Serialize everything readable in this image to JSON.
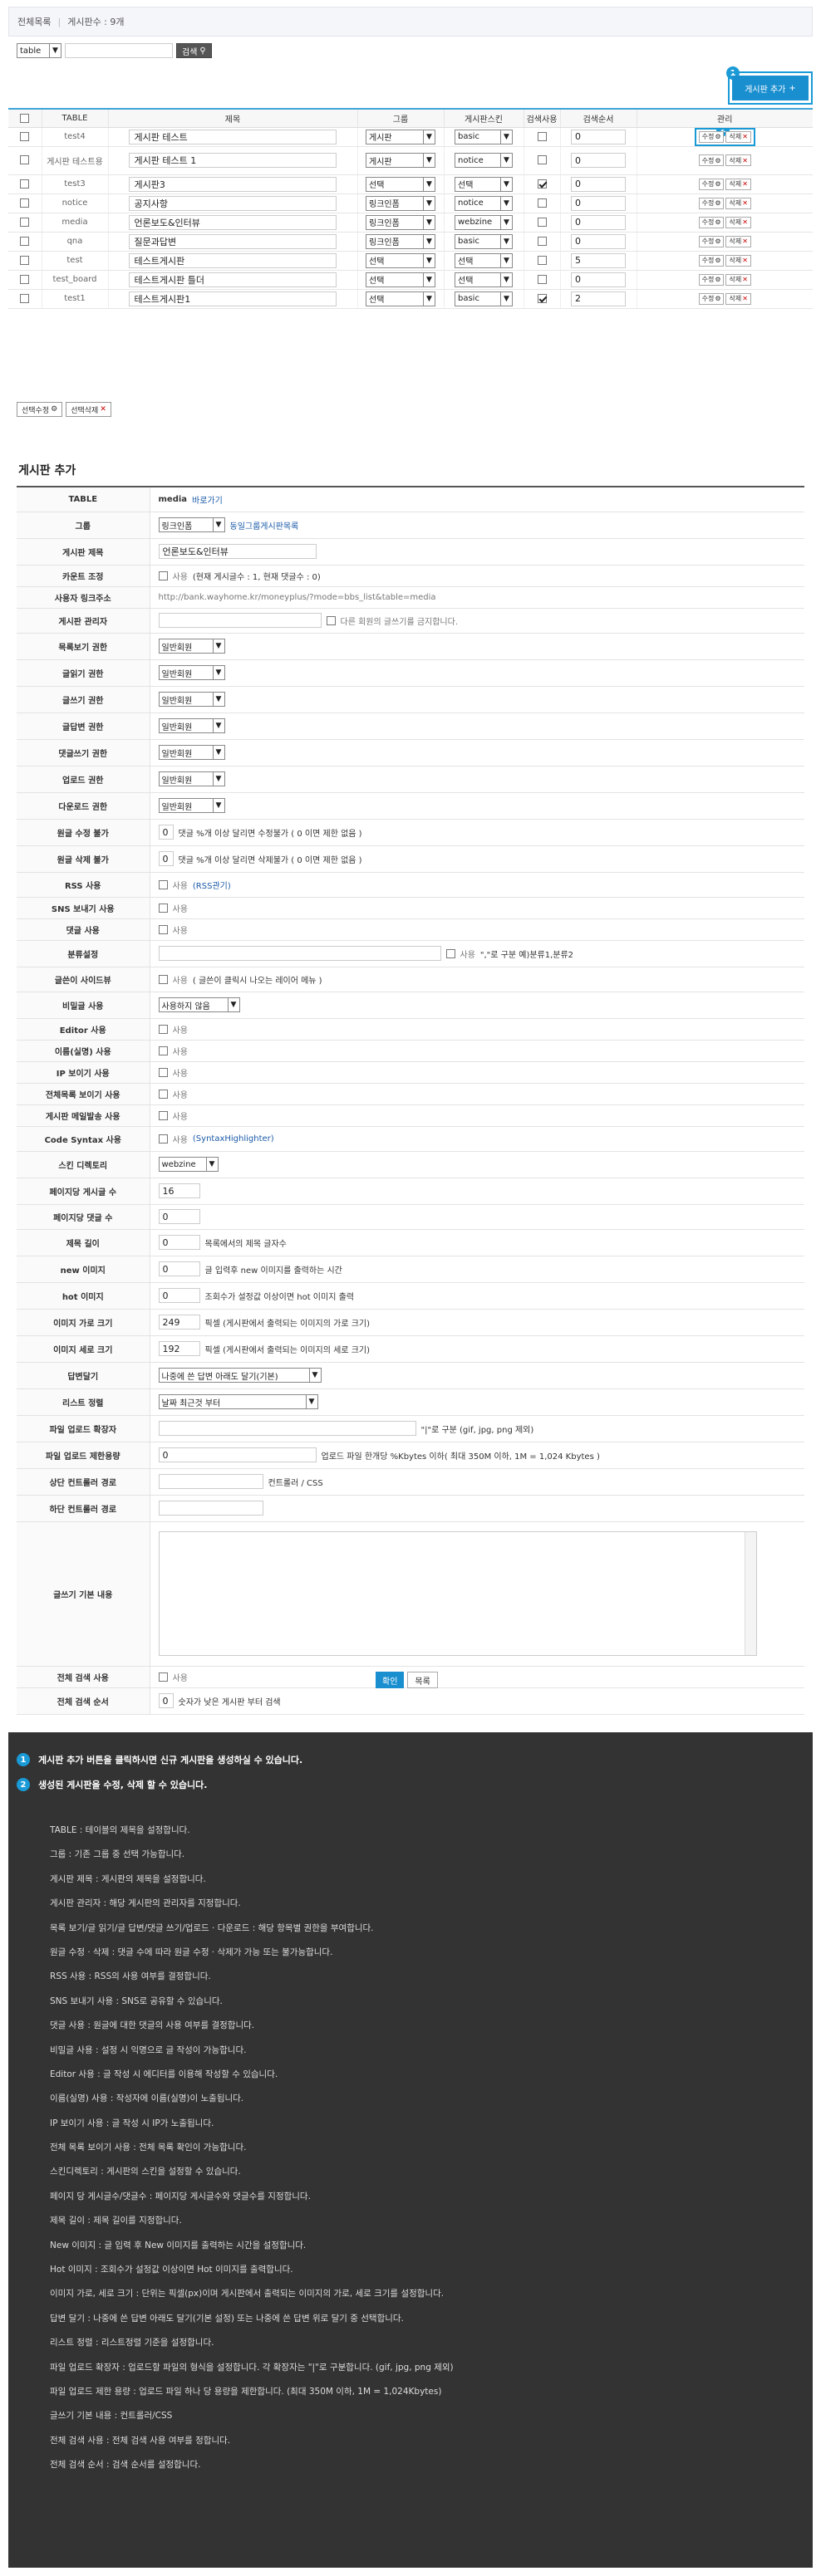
{
  "breadcrumb": {
    "title": "전체목록",
    "count_label": "게시판수 : 9개"
  },
  "search": {
    "field_value": "table",
    "query": "",
    "button": "검색"
  },
  "add_button": {
    "label": "게시판 추가",
    "badge1": "1",
    "badge2": "2"
  },
  "list": {
    "headers": [
      "TABLE",
      "제목",
      "그룹",
      "게시판스킨",
      "검색사용",
      "검색순서",
      "관리"
    ],
    "rows": [
      {
        "table": "test4",
        "title": "게시판 테스트",
        "group": "게시판",
        "skin": "basic",
        "search": false,
        "order": "0"
      },
      {
        "table": "게시판 테스트용",
        "title": "게시판 테스트 1",
        "group": "게시판",
        "skin": "notice",
        "search": false,
        "order": "0"
      },
      {
        "table": "test3",
        "title": "게시판3",
        "group": "선택",
        "skin": "선택",
        "search": true,
        "order": "0"
      },
      {
        "table": "notice",
        "title": "공지사항",
        "group": "링크인폼",
        "skin": "notice",
        "search": false,
        "order": "0"
      },
      {
        "table": "media",
        "title": "언론보도&인터뷰",
        "group": "링크인폼",
        "skin": "webzine",
        "search": false,
        "order": "0"
      },
      {
        "table": "qna",
        "title": "질문과답변",
        "group": "링크인폼",
        "skin": "basic",
        "search": false,
        "order": "0"
      },
      {
        "table": "test",
        "title": "테스트게시판",
        "group": "선택",
        "skin": "선택",
        "search": false,
        "order": "5"
      },
      {
        "table": "test_board",
        "title": "테스트게시판 틀더",
        "group": "선택",
        "skin": "선택",
        "search": false,
        "order": "0"
      },
      {
        "table": "test1",
        "title": "테스트게시판1",
        "group": "선택",
        "skin": "basic",
        "search": true,
        "order": "2"
      }
    ],
    "edit_label": "수정",
    "delete_label": "삭제"
  },
  "bulk": {
    "edit": "선택수정",
    "delete": "선택삭제"
  },
  "form": {
    "section_title": "게시판 추가",
    "labels": [
      "TABLE",
      "그룹",
      "게시판 제목",
      "카운트 조정",
      "사용자 링크주소",
      "게시판 관리자",
      "목록보기 권한",
      "글읽기 권한",
      "글쓰기 권한",
      "글답변 권한",
      "댓글쓰기 권한",
      "업로드 권한",
      "다운로드 권한",
      "원글 수정 불가",
      "원글 삭제 불가",
      "RSS 사용",
      "SNS 보내기 사용",
      "댓글 사용",
      "분류설정",
      "글쓴이 사이드뷰",
      "비밀글 사용",
      "Editor 사용",
      "이름(실명) 사용",
      "IP 보이기 사용",
      "전체목록 보이기 사용",
      "게시판 메일발송 사용",
      "Code Syntax 사용",
      "스킨 디렉토리",
      "페이지당 게시글 수",
      "페이지당 댓글 수",
      "제목 길이",
      "new 이미지",
      "hot 이미지",
      "이미지 가로 크기",
      "이미지 세로 크기",
      "답변달기",
      "리스트 정렬",
      "파일 업로드 확장자",
      "파일 업로드 제한용량",
      "상단 컨트롤러 경로",
      "하단 컨트롤러 경로",
      "글쓰기 기본 내용",
      "전체 검색 사용",
      "전체 검색 순서"
    ],
    "table_value": "media",
    "table_link": "바로가기",
    "group_value": "링크인폼",
    "group_link": "동일그룹게시판목록",
    "title_value": "언론보도&인터뷰",
    "count_use": "사용",
    "count_note": "(현재 게시글수 : 1, 현재 댓글수 : 0)",
    "user_link": "http://bank.wayhome.kr/moneyplus/?mode=bbs_list&table=media",
    "admin_note": "다른 회원의 글쓰기를 금지합니다.",
    "perm_value": "일반회원",
    "edit_lock_value": "0",
    "edit_lock_note": "댓글 %개 이상 달리면 수정불가 ( 0 이면 제한 없음 )",
    "delete_lock_value": "0",
    "delete_lock_note": "댓글 %개 이상 달리면 삭제불가 ( 0 이면 제한 없음 )",
    "use": "사용",
    "rss_link": "(RSS관기)",
    "category_use": "사용",
    "category_note": "\",\"로 구분 예)분류1,분류2",
    "sideview_note": "( 글쓴이 클릭시 나오는 레이어 메뉴 )",
    "secret_value": "사용하지 않음",
    "syntax_link": "(SyntaxHighlighter)",
    "skin_value": "webzine",
    "page_rows": "16",
    "comment_rows": "0",
    "subject_len": "0",
    "subject_note": "목록에서의 제목 글자수",
    "new_value": "0",
    "new_note": "글 입력후 new 이미지를 출력하는 시간",
    "hot_value": "0",
    "hot_note": "조회수가 설정값 이상이면 hot 이미지 출력",
    "img_w": "249",
    "img_w_note": "픽셀 (게시판에서 출력되는 이미지의 가로 크기)",
    "img_h": "192",
    "img_h_note": "픽셀 (게시판에서 출력되는 이미지의 세로 크기)",
    "reply_value": "나중에 쓴 답변 아래도 달기(기본)",
    "sort_value": "날짜 최근것 부터",
    "ext_note": "\"|\"로 구분 (gif, jpg, png 제외)",
    "upload_size": "0",
    "upload_note": "업로드 파일 한개당 %Kbytes 이하( 최대 350M 이하, 1M = 1,024 Kbytes )",
    "head_note": "컨트롤러 / CSS",
    "search_order": "0",
    "search_order_note": "숫자가 낮은 게시판 부터 검색",
    "ok": "확인",
    "list_btn": "목록"
  },
  "help": {
    "top": [
      "게시판 추가 버튼을 클릭하시면 신규 게시판을 생성하실 수 있습니다.",
      "생성된 게시판을 수정, 삭제 할 수 있습니다."
    ],
    "lines": [
      "TABLE : 테이블의 제목을 설정합니다.",
      "그룹 : 기존 그룹 중 선택 가능합니다.",
      "게시판 제목 : 게시판의 제목을 설정합니다.",
      "게시판 관리자 : 해당 게시판의 관리자를 지정합니다.",
      "목록 보기/글 읽기/글 답변/댓글 쓰기/업로드 · 다운로드 : 해당 항목별 권한을 부여합니다.",
      "원글 수정 · 삭제 : 댓글 수에 따라 원글 수정 · 삭제가 가능 또는 불가능합니다.",
      "RSS 사용 : RSS의 사용 여부를 결정합니다.",
      "SNS 보내기 사용 : SNS로 공유할 수 있습니다.",
      "댓글 사용 : 원글에 대한 댓글의 사용 여부를 결정합니다.",
      "비밀글 사용 : 설정 시 익명으로 글 작성이 가능합니다.",
      "Editor 사용 : 글 작성 시 에디터를 이용해 작성할 수 있습니다.",
      "이름(실명) 사용 : 작성자에 이름(실명)이 노출됩니다.",
      "IP 보이기 사용 : 글 작성 시 IP가 노출됩니다.",
      "전체 목록 보이기 사용 : 전체 목록 확인이 가능합니다.",
      "스킨디렉토리 : 게시판의 스킨을 설정할 수 있습니다.",
      "페이지 당 게시글수/댓글수 : 페이지당 게시글수와 댓글수를 지정합니다.",
      "제목 길이 : 제목 길이를 지정합니다.",
      "New 이미지 : 글 입력 후 New 이미지를 출력하는 시간을 설정합니다.",
      "Hot 이미지 : 조회수가 설정값 이상이면 Hot 이미지를 출력합니다.",
      "이미지 가로, 세로 크기 : 단위는 픽셀(px)이며 게시판에서 출력되는 이미지의 가로, 세로 크기를 설정합니다.",
      "답변 달기 : 나중에 쓴 답변 아래도 달기(기본 설정) 또는 나중에 쓴 답변 위로 달기 중 선택합니다.",
      "리스트 정렬 : 리스트정렬 기준을 설정합니다.",
      "파일 업로드 확장자 : 업로드할 파일의 형식을 설정합니다. 각 확장자는 \"|\"로 구분합니다. (gif, jpg, png 제외)",
      "파일 업로드 제한 용량 : 업로드 파일 하나 당 용량을 제한합니다. (최대 350M 이하, 1M = 1,024Kbytes)",
      "글쓰기 기본 내용 : 컨트롤러/CSS",
      "전체 검색 사용 : 전체 검색 사용 여부를 정합니다.",
      "전체 검색 순서 : 검색 순서를 설정합니다."
    ]
  }
}
